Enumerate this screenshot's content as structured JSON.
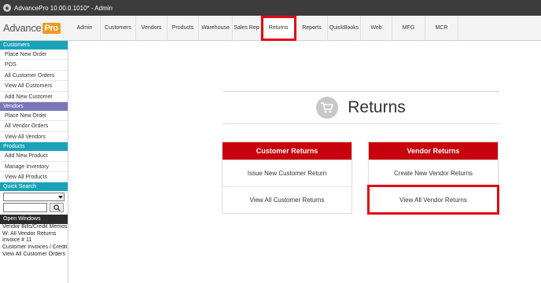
{
  "window": {
    "title": "AdvancePro 10.00.0.1010* - Admin"
  },
  "logo": {
    "text": "Advance",
    "badge": "Pro"
  },
  "nav": {
    "tabs": [
      "Admin",
      "Customers",
      "Vendors",
      "Products",
      "Warehouse",
      "Sales Rep",
      "Returns",
      "Reports",
      "QuickBooks",
      "Web",
      "MFG",
      "MCR"
    ],
    "active": "Returns"
  },
  "sidebar": {
    "customers": {
      "header": "Customers",
      "items": [
        "Place New Order",
        "POS",
        "All Customer Orders",
        "View All Customers",
        "Add New Customer"
      ]
    },
    "vendors": {
      "header": "Vendors",
      "items": [
        "Place New Order",
        "All Vendor Orders",
        "View All Vendors"
      ]
    },
    "products": {
      "header": "Products",
      "items": [
        "Add New Product",
        "Manage Inventory",
        "View All Products"
      ]
    },
    "quick_search": {
      "header": "Quick Search"
    },
    "open_windows": {
      "header": "Open Windows",
      "items": [
        "Vendor Bills/Credit Memos",
        "W: All Vendor Returns",
        "Invoice # 11",
        "Customer Invoices / Credit I",
        "View All Customer Orders"
      ]
    }
  },
  "main": {
    "title": "Returns",
    "customer_returns": {
      "header": "Customer Returns",
      "items": [
        "Issue New Customer Return",
        "View All Customer Returns"
      ]
    },
    "vendor_returns": {
      "header": "Vendor Returns",
      "items": [
        "Create New Vendor Returns",
        "View All Vendor Returns"
      ]
    }
  },
  "colors": {
    "accent_red": "#c8010d",
    "highlight_red": "#e30613",
    "teal": "#1aa3b8",
    "purple": "#7a77b8",
    "logo_orange": "#f29a1e"
  },
  "icons": {
    "app": "app-icon",
    "cart": "cart-icon",
    "search": "search-icon",
    "dropdown": "chevron-down-icon"
  }
}
